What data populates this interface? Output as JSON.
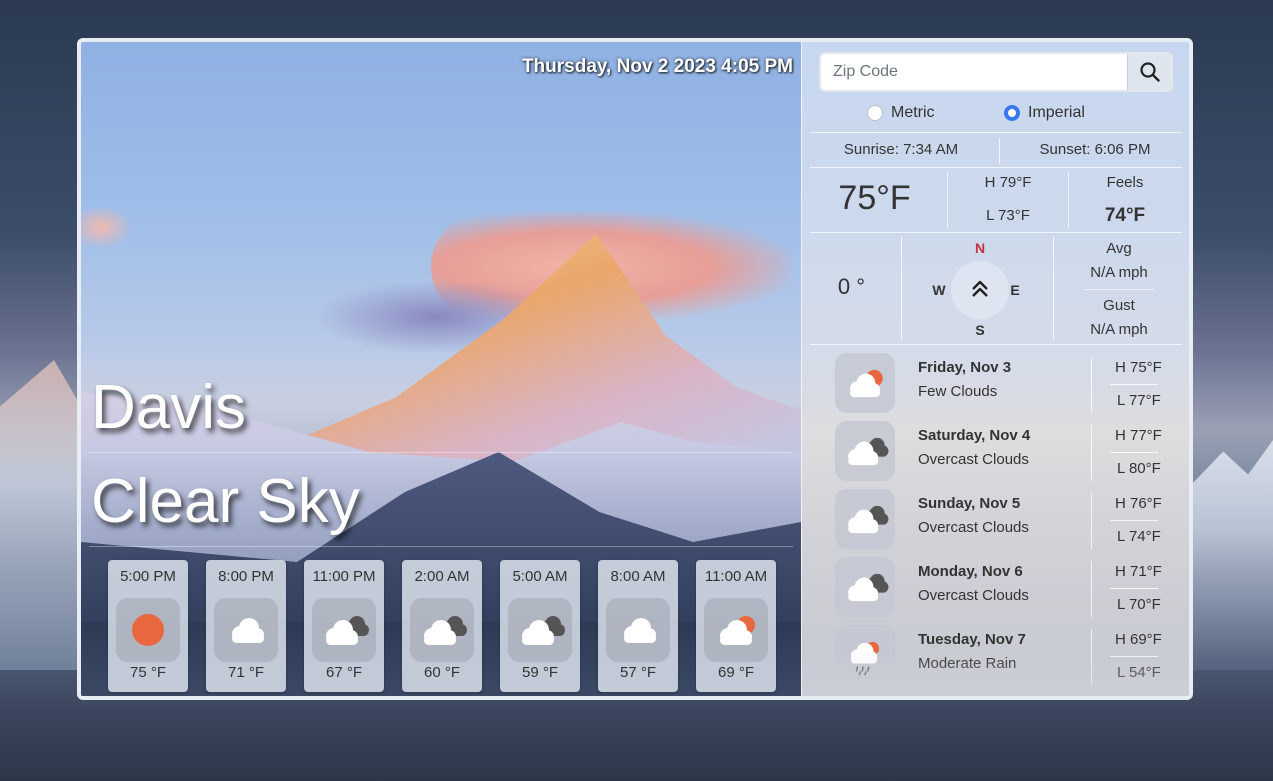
{
  "datetime": "Thursday, Nov 2 2023 4:05 PM",
  "location": {
    "city": "Davis",
    "condition": "Clear Sky"
  },
  "hourly": [
    {
      "time": "5:00 PM",
      "temp": "75 °F",
      "icon": "sun-icon"
    },
    {
      "time": "8:00 PM",
      "temp": "71 °F",
      "icon": "cloud-icon"
    },
    {
      "time": "11:00 PM",
      "temp": "67 °F",
      "icon": "overcast-cloud-icon"
    },
    {
      "time": "2:00 AM",
      "temp": "60 °F",
      "icon": "overcast-cloud-icon"
    },
    {
      "time": "5:00 AM",
      "temp": "59 °F",
      "icon": "overcast-cloud-icon"
    },
    {
      "time": "8:00 AM",
      "temp": "57 °F",
      "icon": "cloud-icon"
    },
    {
      "time": "11:00 AM",
      "temp": "69 °F",
      "icon": "few-clouds-icon"
    }
  ],
  "search": {
    "placeholder": "Zip Code"
  },
  "units": {
    "metric": "Metric",
    "imperial": "Imperial",
    "selected": "imperial"
  },
  "sun": {
    "sunrise": "Sunrise: 7:34 AM",
    "sunset": "Sunset: 6:06 PM"
  },
  "current": {
    "temp": "75°F",
    "high": "H 79°F",
    "low": "L 73°F",
    "feels_label": "Feels",
    "feels_value": "74°F"
  },
  "wind": {
    "degrees": "0 °",
    "n": "N",
    "s": "S",
    "e": "E",
    "w": "W",
    "avg_label": "Avg",
    "avg_value": "N/A mph",
    "gust_label": "Gust",
    "gust_value": "N/A mph"
  },
  "daily": [
    {
      "day": "Friday, Nov 3",
      "condition": "Few Clouds",
      "high": "H 75°F",
      "low": "L 77°F",
      "icon": "few-clouds-icon"
    },
    {
      "day": "Saturday, Nov 4",
      "condition": "Overcast Clouds",
      "high": "H 77°F",
      "low": "L 80°F",
      "icon": "overcast-cloud-icon"
    },
    {
      "day": "Sunday, Nov 5",
      "condition": "Overcast Clouds",
      "high": "H 76°F",
      "low": "L 74°F",
      "icon": "overcast-cloud-icon"
    },
    {
      "day": "Monday, Nov 6",
      "condition": "Overcast Clouds",
      "high": "H 71°F",
      "low": "L 70°F",
      "icon": "overcast-cloud-icon"
    },
    {
      "day": "Tuesday, Nov 7",
      "condition": "Moderate Rain",
      "high": "H 69°F",
      "low": "L 54°F",
      "icon": "rain-icon"
    }
  ],
  "colors": {
    "accent": "#3a78f2",
    "sun": "#e8673f",
    "north": "#c8323c"
  }
}
